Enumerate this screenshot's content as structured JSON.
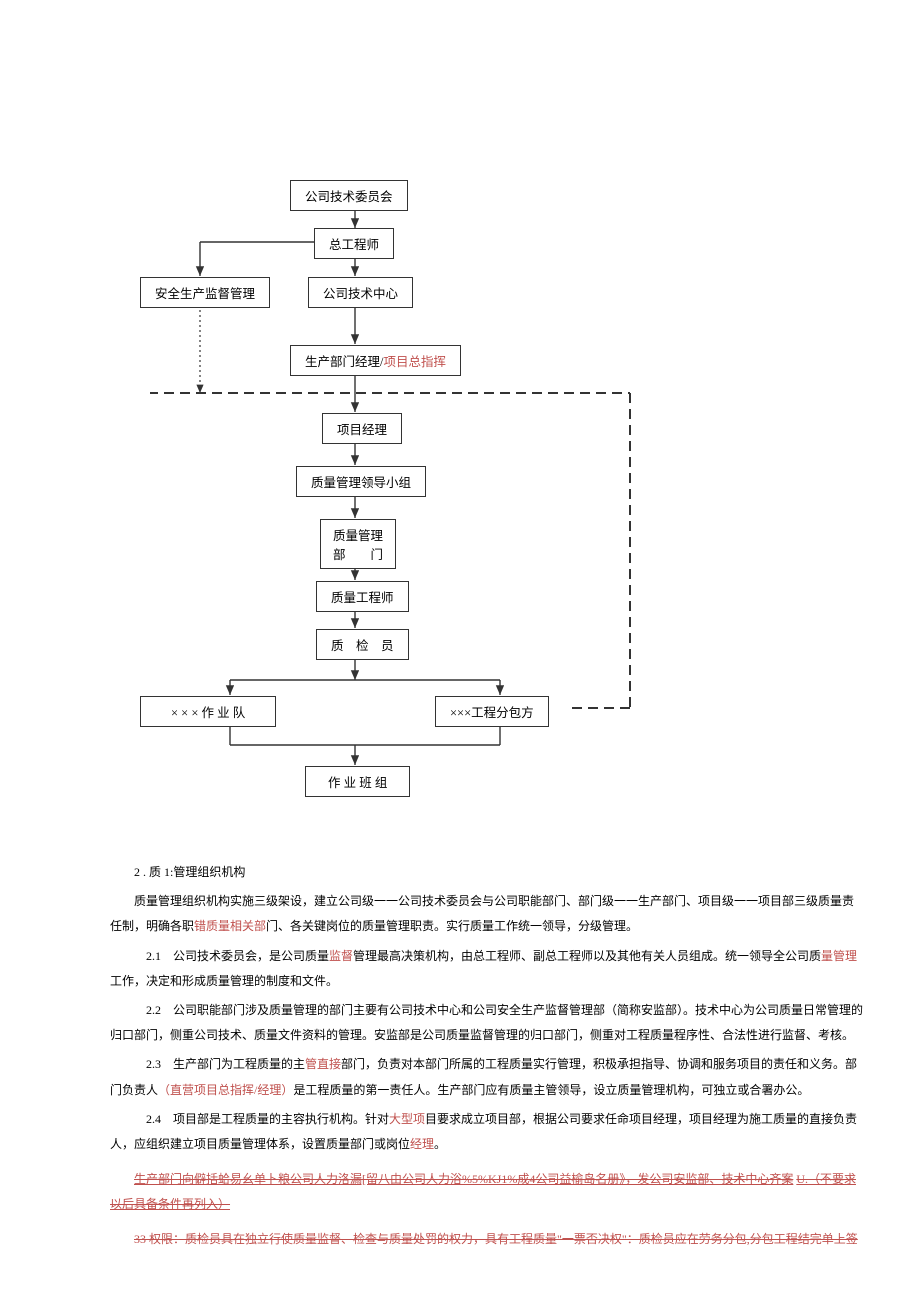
{
  "diagram": {
    "n1": "公司技术委员会",
    "n2": "总工程师",
    "n3": "安全生产监督管理",
    "n4": "公司技术中心",
    "n5a": "生产部门经理/",
    "n5b": "项目总指挥",
    "n6": "项目经理",
    "n7": "质量管理领导小组",
    "n8a": "质量管理",
    "n8b": "部　　门",
    "n9": "质量工程师",
    "n10": "质　检　员",
    "n11": "× × × 作 业 队",
    "n12": "×××工程分包方",
    "n13": "作 业 班 组"
  },
  "text": {
    "sec2_title": "2 . 质 1:管理组织机构",
    "p1a": "质量管理组织机构实施三级架设，建立公司级一一公司技术委员会与公司职能部门、部门级一一生产部门、项目级一一项目部三级质量责任制，明确各职",
    "p1b": "错质量相关部",
    "p1c": "门、各关键岗位的质量管理职责。实行质量工作统一领导，分级管理。",
    "p21a": "2.1　公司技术委员会，是公司质量",
    "p21b": "监督",
    "p21c": "管理最高决策机构，由总工程师、副总工程师以及其他有关人员组成。统一领导全公司质",
    "p21d": "量管理",
    "p21e": "工作，决定和形成质量管理的制度和文件。",
    "p22": "2.2　公司职能部门涉及质量管理的部门主要有公司技术中心和公司安全生产监督管理部（简称安监部）。技术中心为公司质量日常管理的归口部门，侧重公司技术、质量文件资料的管理。安监部是公司质量监督管理的归口部门，侧重对工程质量程序性、合法性进行监督、考核。",
    "p23a": "2.3　生产部门为工程质量的主",
    "p23b": "管直接",
    "p23c": "部门，负责对本部门所属的工程质量实行管理，积极承担指导、协调和服务项目的责任和义务。部门负责人",
    "p23d": "（直营项目总指挥/经理）",
    "p23e": "是工程质量的第一责任人。生产部门应有质量主管领导，设立质量管理机构，可独立或合署办公。",
    "p24a": "2.4　项目部是工程质量的主容执行机构。针对",
    "p24b": "大型项",
    "p24c": "目要求成立项目部，根据公司要求任命项目经理，项目经理为施工质量的直接负责人，应组织建立项目质量管理体系，设置质量部门或岗位",
    "p24d": "经理",
    "p24e": "。",
    "crossed1a": "生产部门向僻括蛤易幺单卜粮公司人力洛漏[留八由公司人力浴%5%KJ1%成4公司益榆岛名册》，发公司安监部、技术中心齐案",
    "crossed1b": "U.（不要求以后具备条件再列入）",
    "crossed2": "33 权限：质检员具在独立行使质量监督、检查与质量处罚的权力，具有工程质量\"一票否决权\"：质检员应在劳务分包,分包工程结完单上签"
  }
}
